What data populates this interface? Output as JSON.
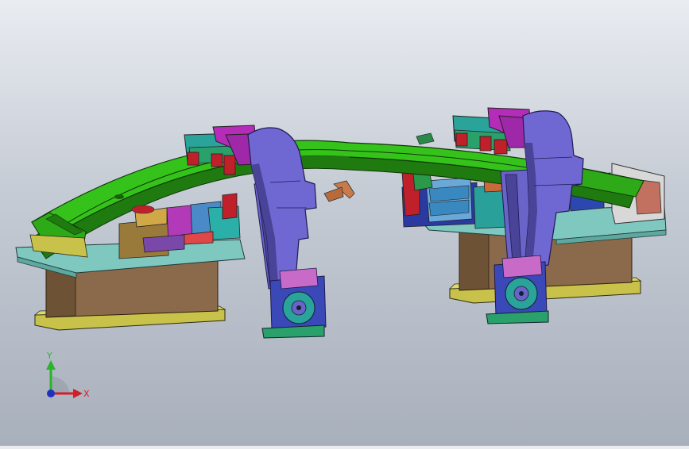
{
  "viewport": {
    "colors": {
      "background_top": "#e9ecf1",
      "background_bottom": "#a8b0bc",
      "rail": "#35c21a",
      "rail_dark": "#1f7a10",
      "clamp_arm": "#6a63c8",
      "clamp_arm_dark": "#4a4498",
      "magenta": "#b42cb8",
      "teal": "#2aa39a",
      "base_brown": "#8a6a4a",
      "base_teal": "#7fc8c0",
      "yellow_plate": "#c9c24a",
      "red": "#c0202a"
    }
  },
  "triad": {
    "y_label": "Y",
    "x_label": "X",
    "y_color": "#2cb32c",
    "x_color": "#d0202a",
    "z_color": "#2030c0"
  }
}
